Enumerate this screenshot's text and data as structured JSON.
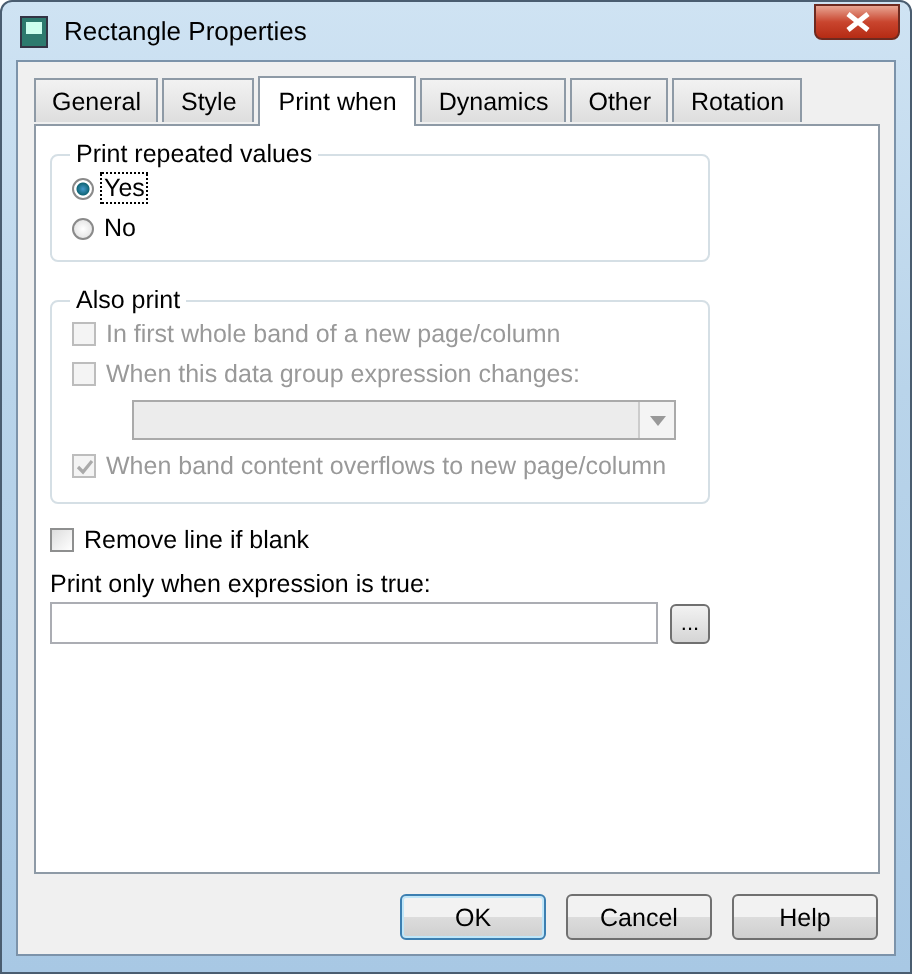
{
  "window": {
    "title": "Rectangle Properties"
  },
  "tabs": [
    {
      "label": "General",
      "selected": false
    },
    {
      "label": "Style",
      "selected": false
    },
    {
      "label": "Print when",
      "selected": true
    },
    {
      "label": "Dynamics",
      "selected": false
    },
    {
      "label": "Other",
      "selected": false
    },
    {
      "label": "Rotation",
      "selected": false
    }
  ],
  "print_repeated_values": {
    "title": "Print repeated values",
    "options": [
      {
        "label": "Yes",
        "selected": true
      },
      {
        "label": "No",
        "selected": false
      }
    ]
  },
  "also_print": {
    "title": "Also print",
    "disabled": true,
    "items": [
      {
        "kind": "checkbox",
        "label": "In first whole band of a new page/column",
        "checked": false
      },
      {
        "kind": "checkbox",
        "label": "When this data group expression changes:",
        "checked": false
      },
      {
        "kind": "dropdown"
      },
      {
        "kind": "checkbox",
        "label": "When band content overflows to new page/column",
        "checked": true
      }
    ]
  },
  "remove_line_if_blank": {
    "label": "Remove line if blank",
    "checked": false
  },
  "print_expression": {
    "label": "Print only when expression is true:",
    "browse_button": "..."
  },
  "buttons": [
    "OK",
    "Cancel",
    "Help"
  ]
}
